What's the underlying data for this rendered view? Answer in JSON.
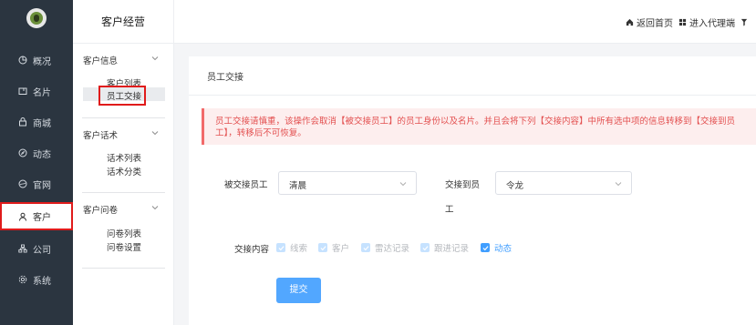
{
  "nav": {
    "items": [
      {
        "label": "概况",
        "icon": "dashboard-icon"
      },
      {
        "label": "名片",
        "icon": "card-icon"
      },
      {
        "label": "商城",
        "icon": "shop-icon"
      },
      {
        "label": "动态",
        "icon": "compass-icon"
      },
      {
        "label": "官网",
        "icon": "globe-icon"
      },
      {
        "label": "客户",
        "icon": "user-icon"
      },
      {
        "label": "公司",
        "icon": "org-icon"
      },
      {
        "label": "系统",
        "icon": "gear-icon"
      }
    ],
    "active_index": 5
  },
  "subnav": {
    "title": "客户经营",
    "groups": [
      {
        "label": "客户信息",
        "links": [
          "客户列表",
          "员工交接"
        ]
      },
      {
        "label": "客户话术",
        "links": [
          "话术列表",
          "话术分类"
        ]
      },
      {
        "label": "客户问卷",
        "links": [
          "问卷列表",
          "问卷设置"
        ]
      }
    ],
    "active_link": "员工交接"
  },
  "topbar": {
    "home": "返回首页",
    "agent": "进入代理端"
  },
  "page": {
    "title": "员工交接",
    "alert": "员工交接请慎重，该操作会取消【被交接员工】的员工身份以及名片。并且会将下列【交接内容】中所有选中项的信息转移到【交接到员工】，转移后不可恢复。",
    "from_label": "被交接员工",
    "from_value": "清晨",
    "to_label_line1": "交接到员",
    "to_label_line2": "工",
    "to_value": "令龙",
    "content_label": "交接内容",
    "options": [
      {
        "label": "线索",
        "checked": true,
        "disabled": true
      },
      {
        "label": "客户",
        "checked": true,
        "disabled": true
      },
      {
        "label": "雷达记录",
        "checked": true,
        "disabled": true
      },
      {
        "label": "跟进记录",
        "checked": true,
        "disabled": true
      },
      {
        "label": "动态",
        "checked": true,
        "disabled": false
      }
    ],
    "submit": "提交"
  },
  "colors": {
    "nav_bg": "#2b3540",
    "accent": "#409eff",
    "alert_text": "#e35050",
    "highlight": "#e01b1b"
  }
}
